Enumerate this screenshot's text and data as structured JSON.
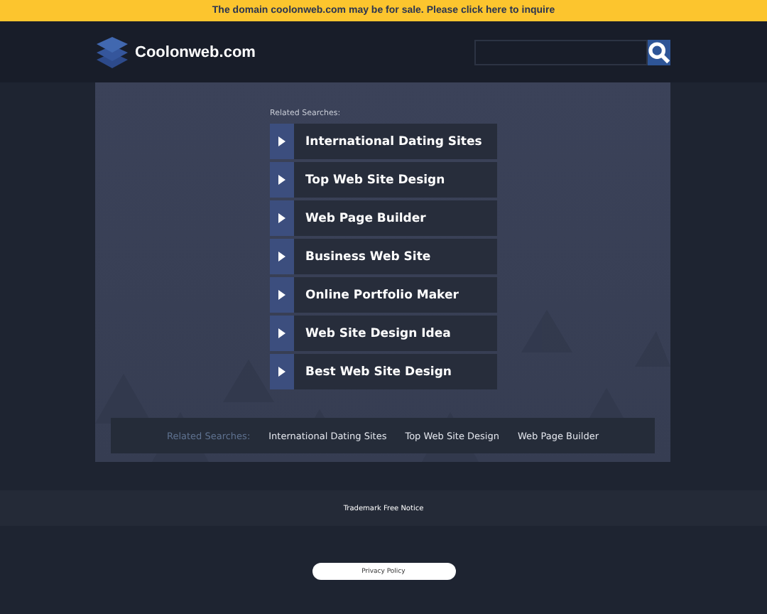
{
  "banner": {
    "text": "The domain coolonweb.com may be for sale. Please click here to inquire"
  },
  "header": {
    "site_name": "Coolonweb.com"
  },
  "related": {
    "label": "Related Searches:",
    "items": [
      {
        "label": "International Dating Sites"
      },
      {
        "label": "Top Web Site Design"
      },
      {
        "label": "Web Page Builder"
      },
      {
        "label": "Business Web Site"
      },
      {
        "label": "Online Portfolio Maker"
      },
      {
        "label": "Web Site Design Idea"
      },
      {
        "label": "Best Web Site Design"
      }
    ]
  },
  "related_bar": {
    "label": "Related Searches:",
    "links": [
      "International Dating Sites",
      "Top Web Site Design",
      "Web Page Builder"
    ]
  },
  "footer": {
    "notice": "Trademark Free Notice",
    "privacy": "Privacy Policy"
  }
}
